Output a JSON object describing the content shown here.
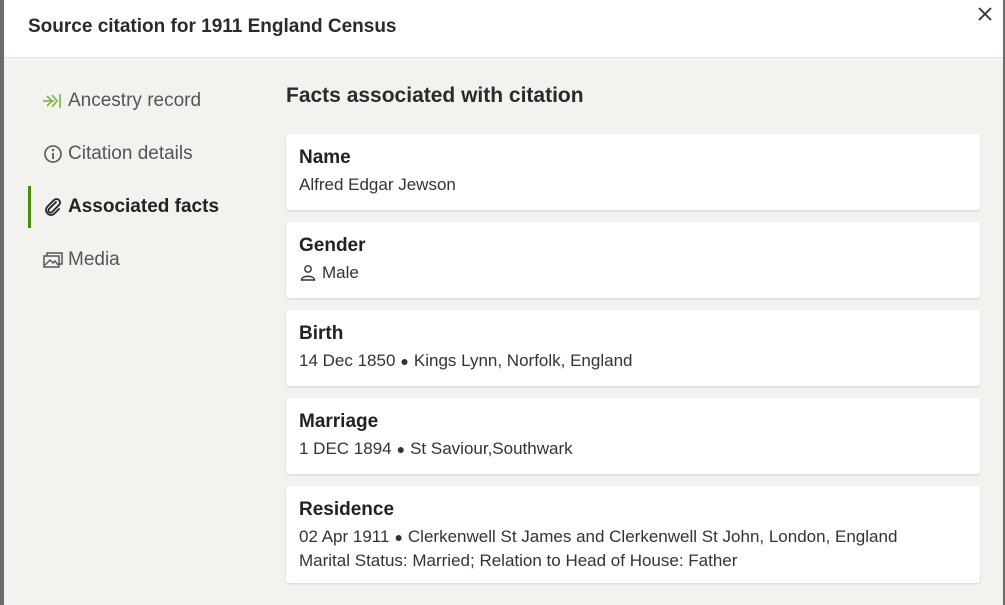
{
  "modal": {
    "title": "Source citation for 1911 England Census"
  },
  "sidebar": {
    "items": [
      {
        "label": "Ancestry record",
        "icon": "ancestry-leaf-icon"
      },
      {
        "label": "Citation details",
        "icon": "info-icon"
      },
      {
        "label": "Associated facts",
        "icon": "paperclip-icon",
        "active": true
      },
      {
        "label": "Media",
        "icon": "image-icon"
      }
    ]
  },
  "main": {
    "section_title": "Facts associated with citation",
    "facts": [
      {
        "label": "Name",
        "value": "Alfred Edgar Jewson"
      },
      {
        "label": "Gender",
        "value": "Male",
        "icon": "person-icon"
      },
      {
        "label": "Birth",
        "date": "14 Dec 1850",
        "place": "Kings Lynn, Norfolk, England"
      },
      {
        "label": "Marriage",
        "date": "1 DEC 1894",
        "place": "St Saviour,Southwark"
      },
      {
        "label": "Residence",
        "date": "02 Apr 1911",
        "place": "Clerkenwell St James and Clerkenwell St John, London, England",
        "details": "Marital Status: Married; Relation to Head of House: Father"
      }
    ]
  },
  "colors": {
    "accent": "#4f8a10",
    "panel_background": "#f4f2ef"
  }
}
